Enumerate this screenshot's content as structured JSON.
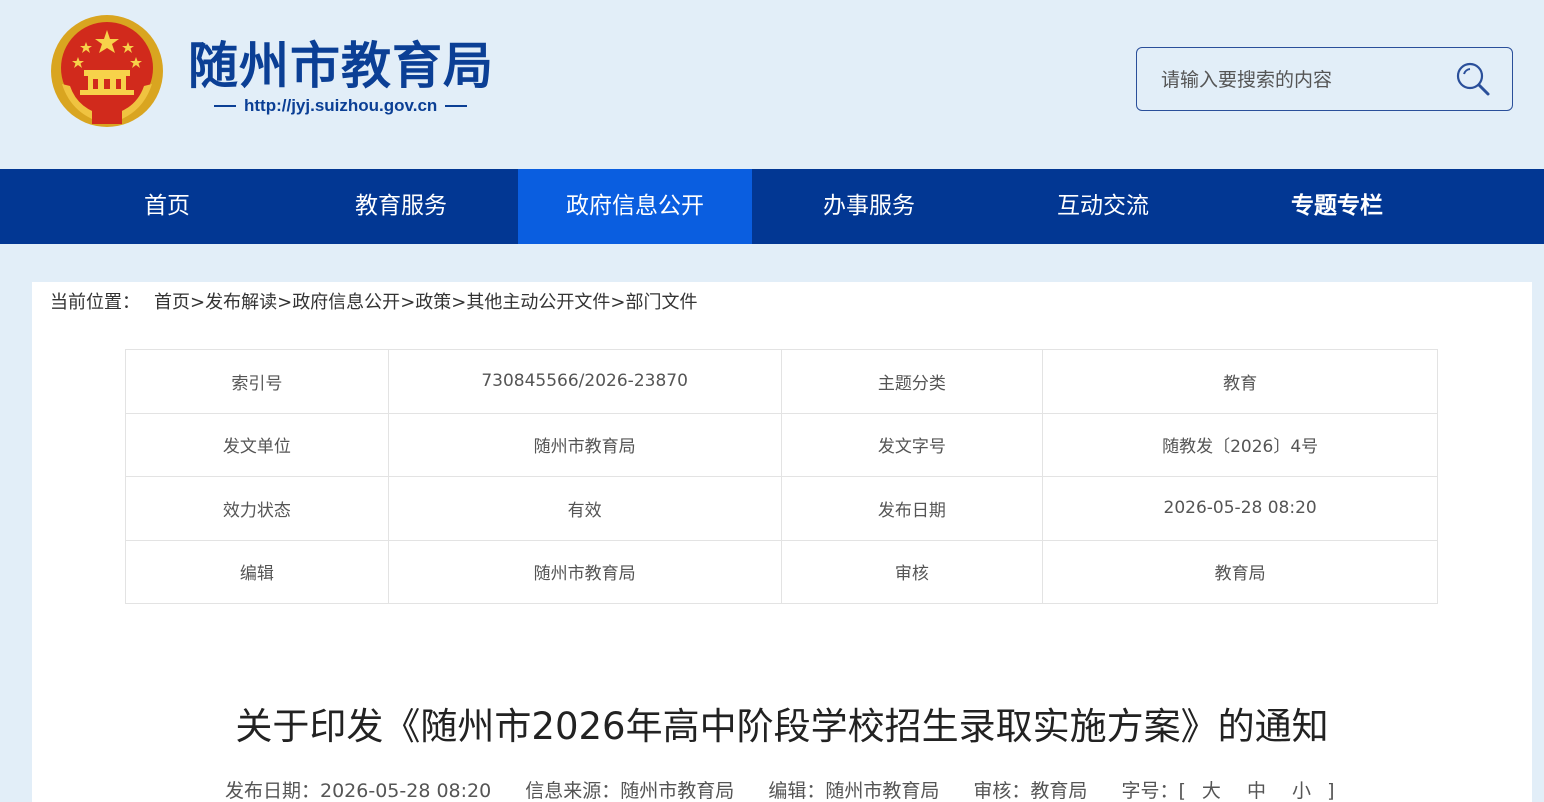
{
  "header": {
    "site_title": "随州市教育局",
    "site_url": "http://jyj.suizhou.gov.cn",
    "emblem_icon": "national-emblem-icon",
    "search_placeholder": "请输入要搜索的内容",
    "search_icon": "search-icon",
    "colors": {
      "brand": "#0b3f95",
      "background": "#e2eef8"
    }
  },
  "nav": {
    "items": [
      {
        "label": "首页"
      },
      {
        "label": "教育服务"
      },
      {
        "label": "政府信息公开",
        "active": true
      },
      {
        "label": "办事服务"
      },
      {
        "label": "互动交流"
      },
      {
        "label": "专题专栏"
      }
    ],
    "colors": {
      "bar": "#023793",
      "active": "#0a5ee0"
    }
  },
  "breadcrumb": {
    "lead": "当前位置：",
    "items": [
      "首页",
      "发布解读",
      "政府信息公开",
      "政策",
      "其他主动公开文件",
      "部门文件"
    ],
    "separator": ">"
  },
  "meta": {
    "rows": [
      {
        "k1": "索引号",
        "v1": "730845566/2026-23870",
        "k2": "主题分类",
        "v2": "教育"
      },
      {
        "k1": "发文单位",
        "v1": "随州市教育局",
        "k2": "发文字号",
        "v2": "随教发〔2026〕4号"
      },
      {
        "k1": "效力状态",
        "v1": "有效",
        "k2": "发布日期",
        "v2": "2026-05-28 08:20"
      },
      {
        "k1": "编辑",
        "v1": "随州市教育局",
        "k2": "审核",
        "v2": "教育局"
      }
    ]
  },
  "article": {
    "title": "关于印发《随州市2026年高中阶段学校招生录取实施方案》的通知",
    "publish_date": "发布日期：2026-05-28 08:20",
    "source": "信息来源：随州市教育局",
    "editor": "编辑：随州市教育局",
    "reviewer": "审核：教育局",
    "font_size_label": "字号：[",
    "font_size_end": "]",
    "font_sizes": [
      "大",
      "中",
      "小"
    ]
  }
}
